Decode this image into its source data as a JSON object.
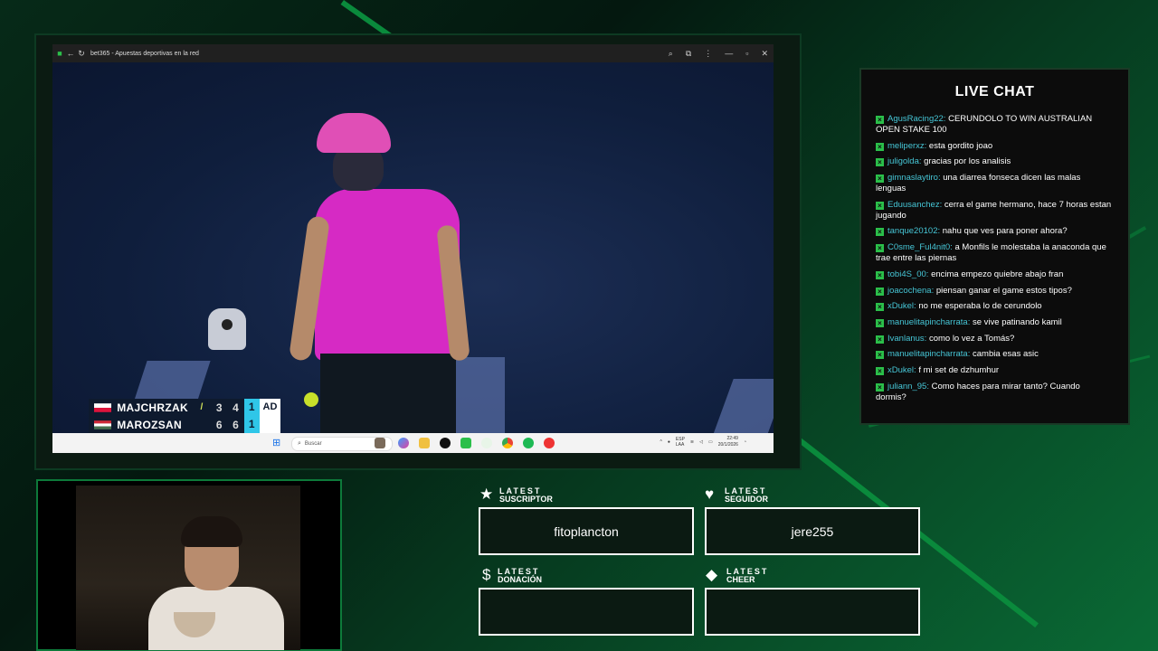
{
  "browser": {
    "title": "bet365 - Apuestas deportivas en la red",
    "icons": [
      "back-icon",
      "reload-icon",
      "zoom-icon",
      "share-icon",
      "more-icon",
      "minimize-icon",
      "maximize-icon",
      "close-icon"
    ]
  },
  "scoreboard": {
    "players": [
      {
        "name": "MAJCHRZAK",
        "sets": [
          "3",
          "4"
        ],
        "games": "1",
        "points": "AD",
        "serving": true,
        "flag_colors": [
          "#ffffff",
          "#dc143c"
        ]
      },
      {
        "name": "MAROZSAN",
        "sets": [
          "6",
          "6"
        ],
        "games": "1",
        "points": "",
        "serving": false,
        "flag_colors": [
          "#ce2939",
          "#ffffff",
          "#477050"
        ]
      }
    ]
  },
  "taskbar": {
    "search_placeholder": "Buscar",
    "tray_lang": "ESP\nLAA",
    "time": "22:49",
    "date": "20/1/2026"
  },
  "chat": {
    "title": "LIVE CHAT",
    "messages": [
      {
        "user": "AgusRacing22:",
        "text": " CERUNDOLO TO WIN AUSTRALIAN OPEN STAKE 100"
      },
      {
        "user": "meliperxz:",
        "text": " esta gordito joao"
      },
      {
        "user": "juligolda:",
        "text": " gracias por los analisis"
      },
      {
        "user": "gimnaslaytiro:",
        "text": " una diarrea fonseca dicen las malas lenguas"
      },
      {
        "user": "Eduusanchez:",
        "text": " cerra el game hermano, hace 7 horas estan jugando"
      },
      {
        "user": "tanque20102:",
        "text": " nahu que ves para poner ahora?"
      },
      {
        "user": "C0sme_Ful4nit0:",
        "text": " a Monfils le molestaba la anaconda que trae entre las piernas"
      },
      {
        "user": "tobi4S_00:",
        "text": " encima empezo quiebre abajo fran"
      },
      {
        "user": "joacochena:",
        "text": " piensan ganar el game estos tipos?"
      },
      {
        "user": "xDukel:",
        "text": " no me esperaba lo de cerundolo"
      },
      {
        "user": "manuelitapincharrata:",
        "text": " se vive patinando kamil"
      },
      {
        "user": "Ivanlanus:",
        "text": " como lo vez a Tomás?"
      },
      {
        "user": "manuelitapincharrata:",
        "text": " cambia esas asic"
      },
      {
        "user": "xDukel:",
        "text": " f mi set de dzhumhur"
      },
      {
        "user": "juliann_95:",
        "text": " Como haces para mirar tanto? Cuando dormis?"
      }
    ]
  },
  "alerts": {
    "subscriber": {
      "small": "LATEST",
      "big": "SUSCRIPTOR",
      "value": "fitoplancton",
      "icon": "star-icon"
    },
    "follower": {
      "small": "LATEST",
      "big": "SEGUIDOR",
      "value": "jere255",
      "icon": "heart-icon"
    },
    "donation": {
      "small": "LATEST",
      "big": "DONACIÓN",
      "value": "",
      "icon": "dollar-icon"
    },
    "cheer": {
      "small": "LATEST",
      "big": "CHEER",
      "value": "",
      "icon": "diamond-icon"
    }
  },
  "colors": {
    "accent": "#0a8a3c",
    "chat_user": "#46c6d6",
    "chat_badge": "#2bbf4a",
    "frame": "#0d7a3a"
  }
}
